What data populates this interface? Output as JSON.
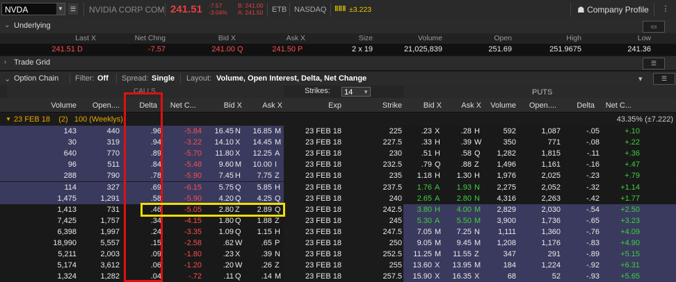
{
  "header": {
    "symbol": "NVDA",
    "company": "NVIDIA CORP COM",
    "last": "241.51",
    "change": "-7.57",
    "change_pct": "-3.04%",
    "bid_line": "B: 241.00",
    "ask_line": "A: 241.50",
    "etb": "ETB",
    "exchange": "NASDAQ",
    "bars_icon": "‖‖‖",
    "bars_change": "±3.223",
    "company_profile": "Company Profile"
  },
  "underlying": {
    "title": "Underlying",
    "headers": [
      "Last X",
      "Net Chng",
      "Bid X",
      "Ask X",
      "Size",
      "Volume",
      "Open",
      "High",
      "Low"
    ],
    "values": {
      "last": "241.51",
      "last_x": "D",
      "net_chng": "-7.57",
      "bid": "241.00",
      "bid_x": "Q",
      "ask": "241.50",
      "ask_x": "P",
      "size": "2 x 19",
      "volume": "21,025,839",
      "open": "251.69",
      "high": "251.9675",
      "low": "241.36"
    }
  },
  "trade_grid": {
    "title": "Trade Grid"
  },
  "option_chain": {
    "title": "Option Chain",
    "filter_label": "Filter:",
    "filter_value": "Off",
    "spread_label": "Spread:",
    "spread_value": "Single",
    "layout_label": "Layout:",
    "layout_value": "Volume, Open Interest, Delta, Net Change",
    "calls_label": "CALLS",
    "puts_label": "PUTS",
    "strikes_label": "Strikes:",
    "strikes_value": "14",
    "col_headers": {
      "volume": "Volume",
      "open_int": "Open....",
      "delta": "Delta",
      "net_chg": "Net C...",
      "bid": "Bid X",
      "ask": "Ask X",
      "exp": "Exp",
      "strike": "Strike",
      "p_bid": "Bid X",
      "p_ask": "Ask X",
      "p_volume": "Volume",
      "p_open_int": "Open....",
      "p_delta": "Delta",
      "p_net_chg": "Net C..."
    },
    "expiry": {
      "label": "23 FEB 18",
      "count": "(2)",
      "desc": "100 (Weeklys)",
      "iv": "43.35% (±7.222)"
    },
    "rows": [
      {
        "cv": "143",
        "co": "440",
        "cd": ".96",
        "cn": "-5.84",
        "cb": "16.45",
        "cbx": "N",
        "ca": "16.85",
        "cax": "M",
        "exp": "23 FEB 18",
        "k": "225",
        "pb": ".23",
        "pbx": "X",
        "pa": ".28",
        "pax": "H",
        "pv": "592",
        "po": "1,087",
        "pd": "-.05",
        "pn": "+.10"
      },
      {
        "cv": "30",
        "co": "319",
        "cd": ".94",
        "cn": "-3.22",
        "cb": "14.10",
        "cbx": "X",
        "ca": "14.45",
        "cax": "M",
        "exp": "23 FEB 18",
        "k": "227.5",
        "pb": ".33",
        "pbx": "H",
        "pa": ".39",
        "pax": "W",
        "pv": "350",
        "po": "771",
        "pd": "-.08",
        "pn": "+.22"
      },
      {
        "cv": "640",
        "co": "770",
        "cd": ".89",
        "cn": "-5.70",
        "cb": "11.80",
        "cbx": "X",
        "ca": "12.25",
        "cax": "A",
        "exp": "23 FEB 18",
        "k": "230",
        "pb": ".51",
        "pbx": "H",
        "pa": ".58",
        "pax": "Q",
        "pv": "1,282",
        "po": "1,815",
        "pd": "-.11",
        "pn": "+.36"
      },
      {
        "cv": "96",
        "co": "511",
        "cd": ".84",
        "cn": "-5.48",
        "cb": "9.60",
        "cbx": "M",
        "ca": "10.00",
        "cax": "I",
        "exp": "23 FEB 18",
        "k": "232.5",
        "pb": ".79",
        "pbx": "Q",
        "pa": ".88",
        "pax": "Z",
        "pv": "1,496",
        "po": "1,161",
        "pd": "-.16",
        "pn": "+.47"
      },
      {
        "cv": "288",
        "co": "790",
        "cd": ".78",
        "cn": "-5.90",
        "cb": "7.45",
        "cbx": "H",
        "ca": "7.75",
        "cax": "Z",
        "exp": "23 FEB 18",
        "k": "235",
        "pb": "1.18",
        "pbx": "H",
        "pa": "1.30",
        "pax": "H",
        "pv": "1,976",
        "po": "2,025",
        "pd": "-.23",
        "pn": "+.79"
      },
      {
        "cv": "114",
        "co": "327",
        "cd": ".69",
        "cn": "-6.15",
        "cb": "5.75",
        "cbx": "Q",
        "ca": "5.85",
        "cax": "H",
        "exp": "23 FEB 18",
        "k": "237.5",
        "pb": "1.76",
        "pbx": "A",
        "pa": "1.93",
        "pax": "N",
        "pv": "2,275",
        "po": "2,052",
        "pd": "-.32",
        "pn": "+1.14"
      },
      {
        "cv": "1,475",
        "co": "1,291",
        "cd": ".58",
        "cn": "-5.90",
        "cb": "4.20",
        "cbx": "Q",
        "ca": "4.25",
        "cax": "Q",
        "exp": "23 FEB 18",
        "k": "240",
        "pb": "2.65",
        "pbx": "A",
        "pa": "2.80",
        "pax": "N",
        "pv": "4,316",
        "po": "2,263",
        "pd": "-.42",
        "pn": "+1.77"
      },
      {
        "cv": "1,413",
        "co": "731",
        "cd": ".46",
        "cn": "-5.05",
        "cb": "2.80",
        "cbx": "Z",
        "ca": "2.89",
        "cax": "Q",
        "exp": "23 FEB 18",
        "k": "242.5",
        "pb": "3.80",
        "pbx": "H",
        "pa": "4.00",
        "pax": "M",
        "pv": "2,829",
        "po": "2,030",
        "pd": "-.54",
        "pn": "+2.50"
      },
      {
        "cv": "7,425",
        "co": "1,757",
        "cd": ".34",
        "cn": "-4.15",
        "cb": "1.80",
        "cbx": "Q",
        "ca": "1.88",
        "cax": "Z",
        "exp": "23 FEB 18",
        "k": "245",
        "pb": "5.30",
        "pbx": "A",
        "pa": "5.50",
        "pax": "M",
        "pv": "3,900",
        "po": "1,736",
        "pd": "-.65",
        "pn": "+3.23"
      },
      {
        "cv": "6,398",
        "co": "1,997",
        "cd": ".24",
        "cn": "-3.35",
        "cb": "1.09",
        "cbx": "Q",
        "ca": "1.15",
        "cax": "H",
        "exp": "23 FEB 18",
        "k": "247.5",
        "pb": "7.05",
        "pbx": "M",
        "pa": "7.25",
        "pax": "N",
        "pv": "1,111",
        "po": "1,360",
        "pd": "-.76",
        "pn": "+4.09"
      },
      {
        "cv": "18,990",
        "co": "5,557",
        "cd": ".15",
        "cn": "-2.58",
        "cb": ".62",
        "cbx": "W",
        "ca": ".65",
        "cax": "P",
        "exp": "23 FEB 18",
        "k": "250",
        "pb": "9.05",
        "pbx": "M",
        "pa": "9.45",
        "pax": "M",
        "pv": "1,208",
        "po": "1,176",
        "pd": "-.83",
        "pn": "+4.90"
      },
      {
        "cv": "5,211",
        "co": "2,003",
        "cd": ".09",
        "cn": "-1.80",
        "cb": ".23",
        "cbx": "X",
        "ca": ".39",
        "cax": "N",
        "exp": "23 FEB 18",
        "k": "252.5",
        "pb": "11.25",
        "pbx": "M",
        "pa": "11.55",
        "pax": "Z",
        "pv": "347",
        "po": "291",
        "pd": "-.89",
        "pn": "+5.15"
      },
      {
        "cv": "5,174",
        "co": "3,612",
        "cd": ".06",
        "cn": "-1.20",
        "cb": ".20",
        "cbx": "W",
        "ca": ".26",
        "cax": "Z",
        "exp": "23 FEB 18",
        "k": "255",
        "pb": "13.60",
        "pbx": "X",
        "pa": "13.95",
        "pax": "M",
        "pv": "184",
        "po": "1,224",
        "pd": "-.92",
        "pn": "+6.31"
      },
      {
        "cv": "1,324",
        "co": "1,282",
        "cd": ".04",
        "cn": "-.72",
        "cb": ".11",
        "cbx": "Q",
        "ca": ".14",
        "cax": "M",
        "exp": "23 FEB 18",
        "k": "257.5",
        "pb": "15.90",
        "pbx": "X",
        "pa": "16.35",
        "pax": "X",
        "pv": "68",
        "po": "52",
        "pd": "-.93",
        "pn": "+5.65"
      }
    ]
  },
  "colors": {
    "bg": "#1a1a1a",
    "itm": "#3a3a5e",
    "otm": "#191919",
    "red": "#ff4d4d",
    "green": "#3cd23c",
    "yellow": "#e8a800",
    "highlight_red": "#e01010",
    "highlight_yellow": "#f0e000"
  }
}
